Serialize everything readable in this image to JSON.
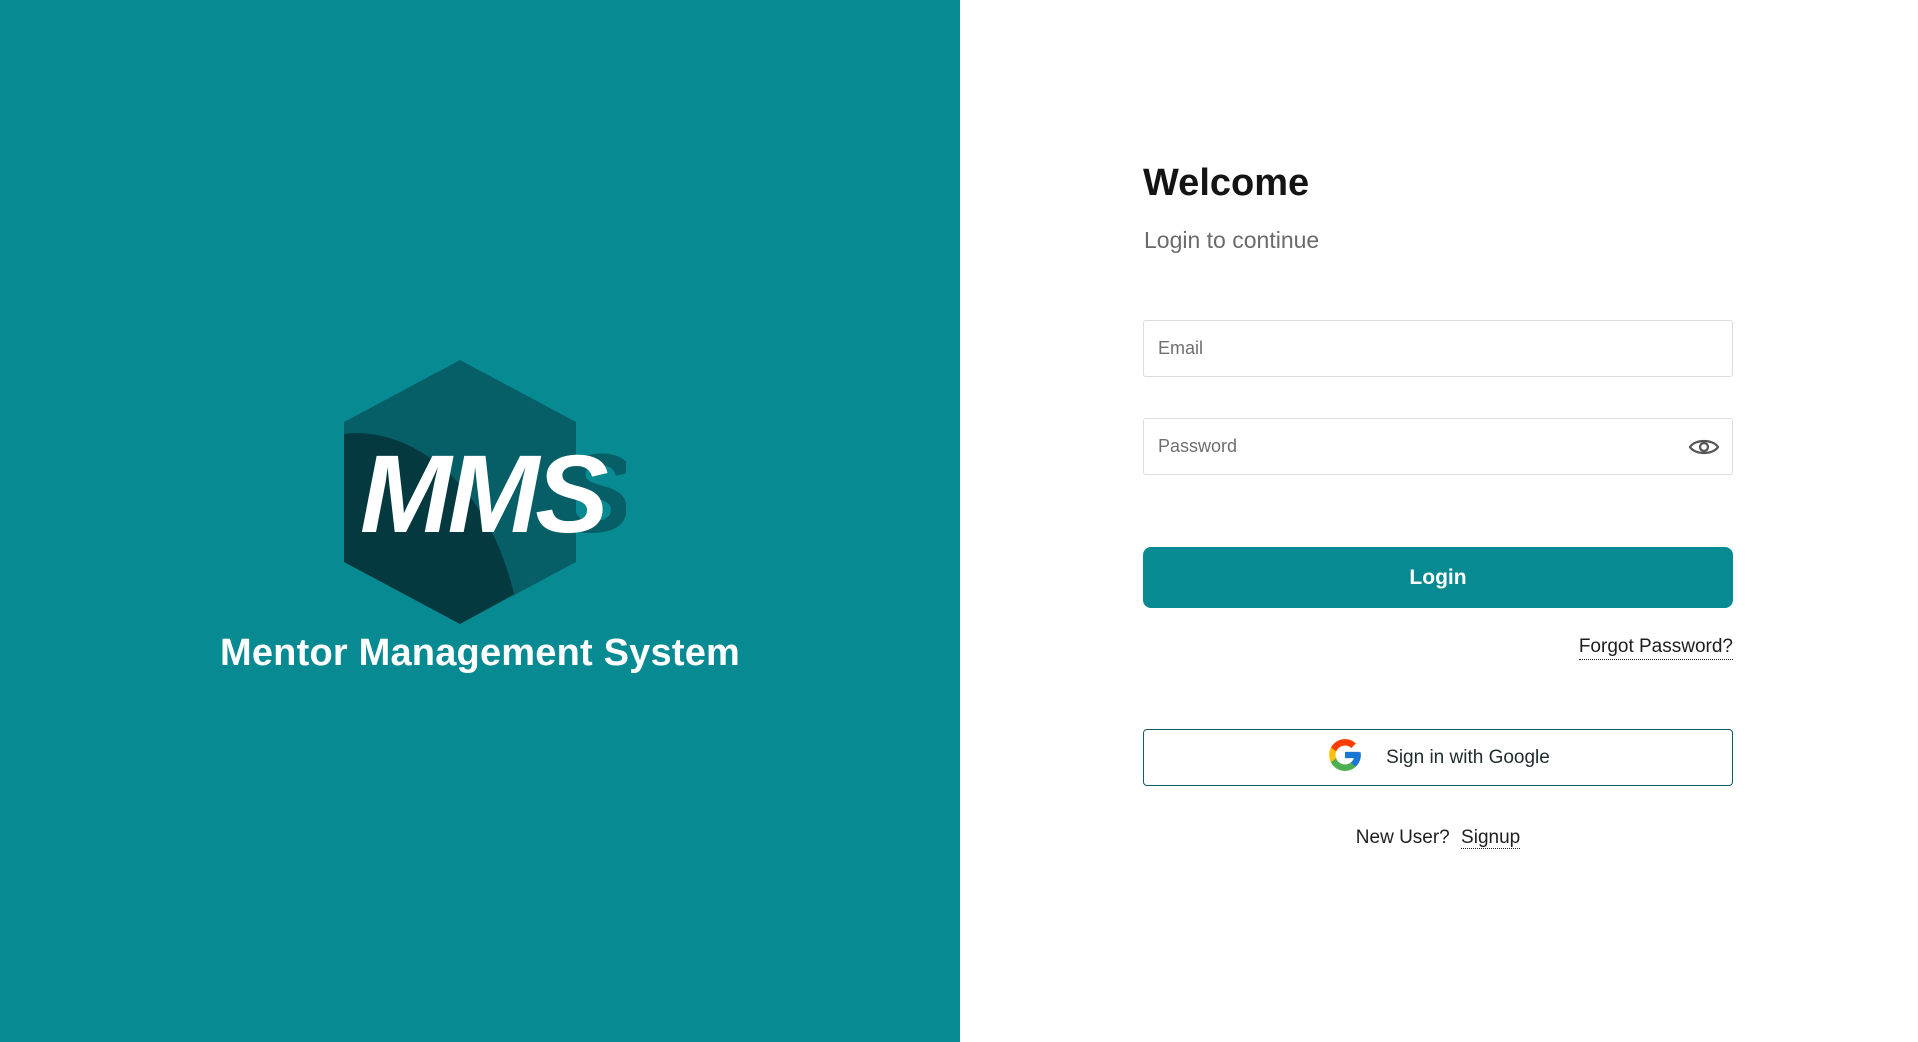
{
  "brand": {
    "logo_text": "MMS",
    "app_name": "Mentor Management System",
    "primary_color": "#088A92",
    "logo_dark_color": "#065F66",
    "logo_darker_color": "#043A3F"
  },
  "login": {
    "title": "Welcome",
    "subtitle": "Login to continue",
    "email_placeholder": "Email",
    "password_placeholder": "Password",
    "login_button": "Login",
    "forgot_password": "Forgot Password?",
    "google_button": "Sign in with Google",
    "new_user_text": "New User?",
    "signup_link": "Signup"
  },
  "icons": {
    "password_toggle": "eye-icon",
    "google": "google-icon"
  }
}
